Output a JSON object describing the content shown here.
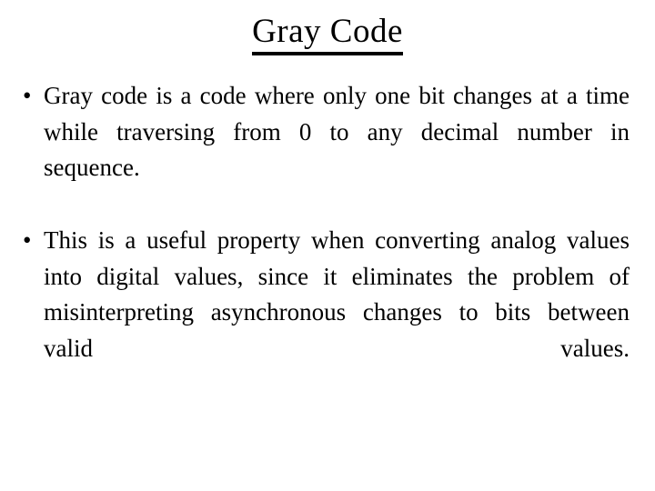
{
  "slide": {
    "title": "Gray Code",
    "bullet_marker": "•",
    "bullets": [
      {
        "text": "Gray code is a code where only one bit changes at a time while traversing from 0 to any decimal number in sequence."
      },
      {
        "text": "This is a useful property when converting analog values into digital values, since it eliminates the problem of misinterpreting asynchronous changes to bits between valid values."
      }
    ],
    "colors": {
      "background": "#ffffff",
      "text": "#000000",
      "title_underline": "#000000"
    }
  }
}
